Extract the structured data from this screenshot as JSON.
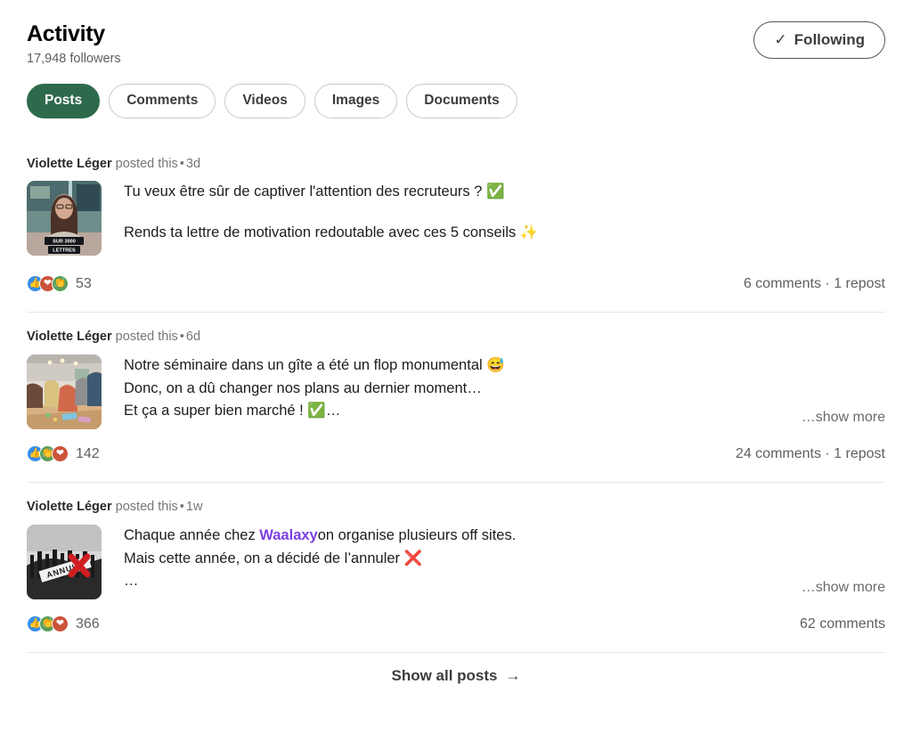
{
  "header": {
    "title": "Activity",
    "followers": "17,948 followers",
    "follow_button": {
      "label": "Following",
      "check_glyph": "✓"
    }
  },
  "tabs": [
    {
      "label": "Posts",
      "active": true
    },
    {
      "label": "Comments",
      "active": false
    },
    {
      "label": "Videos",
      "active": false
    },
    {
      "label": "Images",
      "active": false
    },
    {
      "label": "Documents",
      "active": false
    }
  ],
  "colors": {
    "accent_green": "#2d6a4c",
    "mention_purple": "#7b3fe4",
    "reaction_like": "#378fe9",
    "reaction_love": "#cc5439",
    "reaction_celebrate": "#5b9e5b",
    "text_muted": "#5f5f5f"
  },
  "posts": [
    {
      "author": "Violette Léger",
      "action": "posted this",
      "separator": "•",
      "age": "3d",
      "thumbnail": {
        "alt": "woman-talking-video-thumbnail",
        "overlay_line1": "SUR 3000",
        "overlay_line2": "LETTRES"
      },
      "lines": [
        {
          "text": "Tu veux être sûr de captiver l'attention des recruteurs ? ✅"
        },
        {
          "text": ""
        },
        {
          "text": "Rends ta lettre de motivation redoutable avec ces 5 conseils ✨"
        }
      ],
      "show_more": null,
      "reactions": {
        "types": [
          "like",
          "love",
          "celebrate"
        ],
        "count": "53"
      },
      "engagement": "6 comments · 1 repost"
    },
    {
      "author": "Violette Léger",
      "action": "posted this",
      "separator": "•",
      "age": "6d",
      "thumbnail": {
        "alt": "team-seminar-table-photo",
        "overlay_line1": "",
        "overlay_line2": ""
      },
      "lines": [
        {
          "text": "Notre séminaire dans un gîte a été un flop monumental 😅"
        },
        {
          "text": "Donc, on a dû changer nos plans au dernier moment…"
        },
        {
          "text": "Et ça a super bien marché ! ✅…"
        }
      ],
      "show_more": "…show more",
      "reactions": {
        "types": [
          "like",
          "celebrate",
          "love"
        ],
        "count": "142"
      },
      "engagement": "24 comments · 1 repost"
    },
    {
      "author": "Violette Léger",
      "action": "posted this",
      "separator": "•",
      "age": "1w",
      "thumbnail": {
        "alt": "crowd-annule-black-white-photo",
        "overlay_line1": "ANNULÉ",
        "overlay_line2": ""
      },
      "lines": [
        {
          "text": "Chaque année chez ",
          "mention": "Waalaxy",
          "text_after": "on organise plusieurs off sites."
        },
        {
          "text": "Mais cette année, on a décidé de l’annuler ❌"
        },
        {
          "text": "…"
        }
      ],
      "show_more": "…show more",
      "reactions": {
        "types": [
          "like",
          "celebrate",
          "love"
        ],
        "count": "366"
      },
      "engagement": "62 comments"
    }
  ],
  "footer": {
    "show_all_label": "Show all posts",
    "arrow_glyph": "→"
  }
}
